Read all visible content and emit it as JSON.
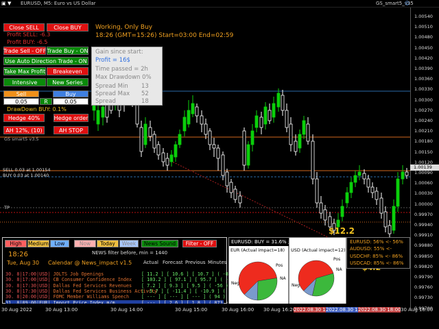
{
  "window": {
    "symbol": "EURUSD, M5:  Euro vs US Dollar",
    "right_title": "GS_smart5_v35"
  },
  "colors": {
    "bull_candle": "#0bcf0b",
    "bear_candle": "#ffffff",
    "red": "#e01010",
    "green": "#0a8a0a",
    "orange_text": "#f0a020"
  },
  "panel": {
    "close_sell": "Close SELL",
    "close_buy": "Close BUY",
    "profit_sell": "Profit SELL: -6.3",
    "profit_buy": "Profit BUY: -6.5",
    "trade_sell": "Trade Sell - OFF",
    "trade_buy": "Trade Buy - ON",
    "auto_direction": "Use Auto Direction Trade - ON",
    "take_max_profit": "Take Max Profit",
    "breakeven": "Breakeven",
    "intensive": "Intensive",
    "new_series": "New Series",
    "sell": "Sell",
    "buy": "Buy",
    "sell_lot": "0.05",
    "r_label": "R",
    "buy_lot": "0.05",
    "drawdown": "DrawDown BUY: 0.1%",
    "hedge": "Hedge 40%",
    "hedge_order": "Hedge order",
    "ah": "AH 12%, (10)",
    "ah_stop": "AH STOP",
    "version": "GS smart5 v3.5"
  },
  "status": {
    "line1": "Working, Only Buy",
    "line2": "18:26 (GMT=15:26) Start=03:00 End=02:59"
  },
  "stats": {
    "gain_label": "Gain since start:",
    "profit": "Profit = 16$",
    "time_passed": "Time passed = 2h",
    "max_dd": "Max Drawdown 0%",
    "spread_min_label": "Spread Min",
    "spread_min": "13",
    "spread_max_label": "Spread Max",
    "spread_max": "52",
    "spread_label": "Spread",
    "spread": "18"
  },
  "chart_labels": {
    "sell_line": "SELL 0.03 at 1.00154",
    "buy_line": "BUY 0.03 at 1.00140",
    "tp": "TP",
    "profit_marker_1": "$12.2",
    "profit_marker_2": "$4.2"
  },
  "price_axis": {
    "labels": [
      "1.00540",
      "1.00510",
      "1.00480",
      "1.00450",
      "1.00420",
      "1.00390",
      "1.00360",
      "1.00330",
      "1.00300",
      "1.00270",
      "1.00240",
      "1.00210",
      "1.00180",
      "1.00150",
      "1.00120",
      "1.00090",
      "1.00060",
      "1.00030",
      "1.00000",
      "0.99970",
      "0.99940",
      "0.99910",
      "0.99880",
      "0.99850",
      "0.99820",
      "0.99790",
      "0.99760",
      "0.99730",
      "0.99700"
    ],
    "current_price": "1.00139",
    "green_marker": "1.00170"
  },
  "news": {
    "tabs": [
      "High",
      "Medium",
      "Low",
      "Now",
      "Today",
      "Week",
      "News Sound",
      "Filter - OFF"
    ],
    "filter_text": "NEWS filter before, min = 1440",
    "time": "18:26",
    "date": "Tue, Aug 30",
    "calendar_title": "Calendar @ News_impact v1.5",
    "columns": [
      "Actual",
      "Forecast",
      "Previous",
      "Minutes"
    ],
    "rows": [
      {
        "d": "30. 8|17:00|USD|",
        "name": "JOLTS Job Openings",
        "vals": "[ 11.2 ] [ 10.6 ] [ 10.7 ]  ( -86 )"
      },
      {
        "d": "30. 8|17:00|USD|",
        "name": "CB Consumer Confidence Index",
        "vals": "[ 103.2 ] [ 97.1 ] [ 95.7 ]  ( -86 )"
      },
      {
        "d": "30. 8|17:30|USD|",
        "name": "Dallas Fed Services Revenues",
        "vals": "[ 7.2 ] [ 9.3 ] [ 9.5 ]  ( -56 )"
      },
      {
        "d": "30. 8|17:30|USD|",
        "name": "Dallas Fed Services Business Activity",
        "vals": "[ -5.7 ] [ -11.4 ] [ -10.9 ]  ( -56 )"
      },
      {
        "d": "30. 8|20:00|USD|",
        "name": "FOMC Member Williams Speech",
        "vals": "[ --- ] [ --- ] [ --- ]  ( 94 )"
      },
      {
        "d": "31. 8|09:00|EUR|",
        "name": "Import Price Index m/m",
        "vals": "[ --- ] [ 2.6 ] [ 1.8 ]  ( 873 )"
      }
    ]
  },
  "pies": {
    "header": "EURUSD:  BUY = 31.6% ; SELL= 68.4%",
    "eur_title": "EUR (Actual impact=18)",
    "usd_title": "USD (Actual impact=12)",
    "pos": "Pos",
    "na": "NA",
    "neg": "Neg",
    "eur_values": {
      "neg": 60,
      "pos": 28,
      "na": 12
    },
    "usd_values": {
      "neg": 58,
      "pos": 33,
      "na": 9
    }
  },
  "correlation": {
    "rows": [
      "EURUSD: 56% <- 56%",
      "AUDUSD: 55% <-",
      "USDCHF: 85% <- 86%",
      "USDCAD: 85% <- 86%"
    ]
  },
  "time_axis": {
    "labels": [
      "30 Aug 2022",
      "30 Aug 13:00",
      "30 Aug 14:00",
      "30 Aug 15:00",
      "30 Aug 16:00",
      "30 Aug 16:20",
      "2022.08.30 17:0",
      "2022.08.30 17:3",
      "2022.08.30 18:00",
      "30 Aug 18:00"
    ]
  }
}
